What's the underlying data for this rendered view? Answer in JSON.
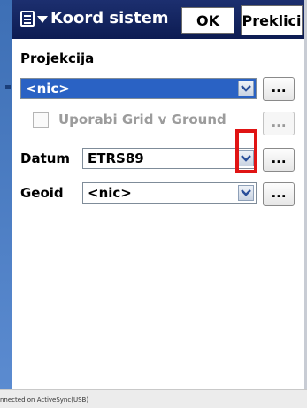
{
  "window": {
    "title": "Koord sistem",
    "icon": "app-menu-icon",
    "ok_label": "OK",
    "cancel_label": "Preklici"
  },
  "projection": {
    "label": "Projekcija",
    "value": "<nic>",
    "selected": true,
    "more_label": "..."
  },
  "grid_to_ground": {
    "label": "Uporabi Grid v Ground",
    "checked": false,
    "enabled": false,
    "more_label": "..."
  },
  "datum": {
    "label": "Datum",
    "value": "ETRS89",
    "more_label": "..."
  },
  "geoid": {
    "label": "Geoid",
    "value": "<nic>",
    "more_label": "..."
  },
  "status": {
    "text": "nnected on ActiveSync(USB)"
  },
  "colors": {
    "titlebar": "#0d1c52",
    "selection": "#2a62c4",
    "highlight": "#e01414",
    "side_strip": "#3d6fb5"
  }
}
